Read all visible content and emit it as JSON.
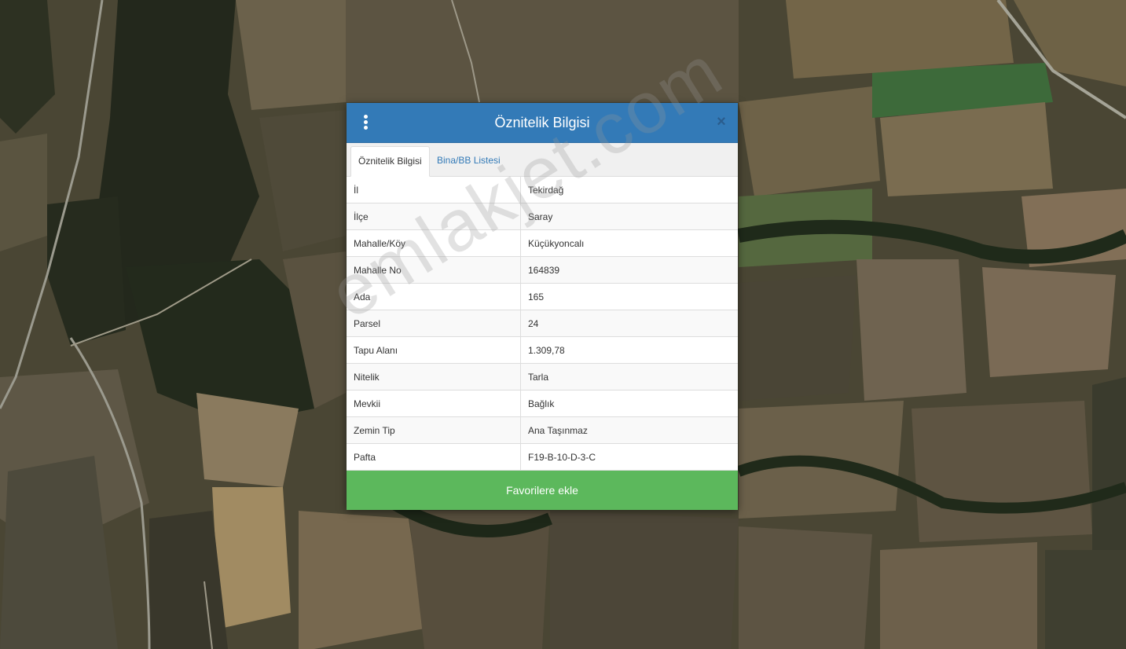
{
  "dialog": {
    "title": "Öznitelik Bilgisi",
    "close_symbol": "×",
    "menu_icon": "kebab-menu-icon",
    "header_color": "#337ab7"
  },
  "tabs": [
    {
      "label": "Öznitelik Bilgisi",
      "active": true
    },
    {
      "label": "Bina/BB Listesi",
      "active": false
    }
  ],
  "attributes": [
    {
      "key": "İl",
      "value": "Tekirdağ"
    },
    {
      "key": "İlçe",
      "value": "Saray"
    },
    {
      "key": "Mahalle/Köy",
      "value": "Küçükyoncalı"
    },
    {
      "key": "Mahalle No",
      "value": "164839"
    },
    {
      "key": "Ada",
      "value": "165"
    },
    {
      "key": "Parsel",
      "value": "24"
    },
    {
      "key": "Tapu Alanı",
      "value": "1.309,78"
    },
    {
      "key": "Nitelik",
      "value": "Tarla"
    },
    {
      "key": "Mevkii",
      "value": "Bağlık"
    },
    {
      "key": "Zemin Tip",
      "value": "Ana Taşınmaz"
    },
    {
      "key": "Pafta",
      "value": "F19-B-10-D-3-C"
    }
  ],
  "favorite_button": {
    "label": "Favorilere ekle",
    "color": "#5cb85c"
  },
  "watermark": "emlakjet.com"
}
